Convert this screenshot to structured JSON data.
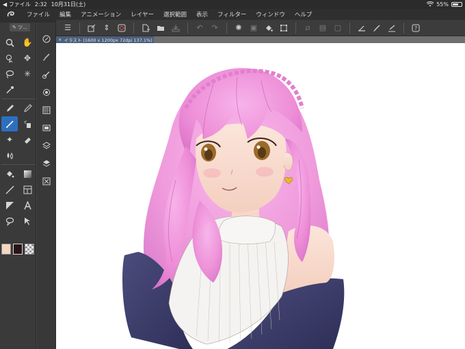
{
  "status_bar": {
    "back_app": "◀ ファイル",
    "time": "2:32",
    "date": "10月31日(土)",
    "battery": "55%",
    "battery_level": 0.55
  },
  "menu": {
    "items": [
      "ファイル",
      "編集",
      "アニメーション",
      "レイヤー",
      "選択範囲",
      "表示",
      "フィルター",
      "ウィンドウ",
      "ヘルプ"
    ]
  },
  "tool_palette": {
    "tab_label": "ツ..."
  },
  "document_tab": {
    "close_glyph": "×",
    "title": "イラスト (1600 x 1200px 72dpi 137.1%)"
  },
  "colors": {
    "main_color": "#f6d6c2",
    "sub_color": "#2a1418",
    "accent_active_tool": "#2d6fbf",
    "hair_pink": "#ee8fd8",
    "jacket_navy": "#3e3f6d"
  },
  "icons": {
    "toolbar": [
      "menu-icon",
      "new-canvas-icon",
      "spin-icon",
      "clip-studio-icon",
      "new-file-icon",
      "open-folder-icon",
      "save-icon",
      "undo-icon",
      "redo-icon",
      "loading-icon",
      "clear-icon",
      "fill-icon",
      "transform-icon",
      "deselect-icon",
      "invert-icon",
      "crop-icon",
      "ruler-icon",
      "brush-icon",
      "ruler-pen-icon",
      "help-icon"
    ]
  }
}
